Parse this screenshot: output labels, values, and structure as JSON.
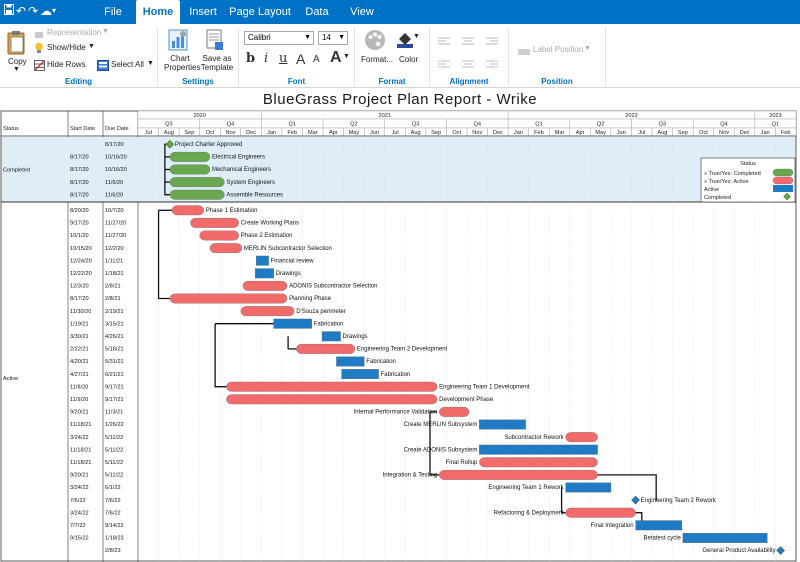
{
  "menu": {
    "tabs": [
      {
        "label": "File"
      },
      {
        "label": "Home"
      },
      {
        "label": "Insert"
      },
      {
        "label": "Page Layout"
      },
      {
        "label": "Data"
      },
      {
        "label": "View"
      }
    ],
    "active_tab": "Home"
  },
  "ribbon": {
    "editing": {
      "group_label": "Editing",
      "copy": "Copy",
      "representation": "Representation",
      "show_hide": "Show/Hide",
      "hide_rows": "Hide Rows",
      "select_all": "Select All"
    },
    "settings": {
      "group_label": "Settings",
      "chart_properties": "Chart Properties",
      "save_template": "Save as Template"
    },
    "font": {
      "group_label": "Font",
      "family": "Calibri",
      "size": "14"
    },
    "format": {
      "group_label": "Format",
      "format_btn": "Format...",
      "color_btn": "Color"
    },
    "alignment": {
      "group_label": "Alignment"
    },
    "position": {
      "group_label": "Position",
      "label_position": "Label Position"
    }
  },
  "report": {
    "title": "BlueGrass Project Plan Report - Wrike",
    "headers": {
      "status": "Status",
      "start": "Start Date",
      "due": "Due Date"
    },
    "years": [
      "2020",
      "2021",
      "2022",
      "2023"
    ],
    "quarters": [
      "Q3",
      "Q4",
      "Q1",
      "Q2",
      "Q3",
      "Q4",
      "Q1",
      "Q2",
      "Q3",
      "Q4",
      "Q1"
    ],
    "months": [
      "Jul",
      "Aug",
      "Sep",
      "Oct",
      "Nov",
      "Dec",
      "Jan",
      "Feb",
      "Mar",
      "Apr",
      "May",
      "Jun",
      "Jul",
      "Aug",
      "Sep",
      "Oct",
      "Nov",
      "Dec",
      "Jan",
      "Feb",
      "Mar",
      "Apr",
      "May",
      "Jun",
      "Jul",
      "Aug",
      "Sep",
      "Oct",
      "Nov",
      "Dec",
      "Jan",
      "Feb"
    ],
    "groups": [
      {
        "label": "Completed"
      },
      {
        "label": "Active"
      }
    ],
    "legend": {
      "title": "Status",
      "items": [
        {
          "label": "» True/Yes: Completed",
          "color": "#6aa84f"
        },
        {
          "label": "» True/Yes: Active",
          "color": "#f26b6b"
        },
        {
          "label": "Active",
          "color": "#1e7bc4"
        },
        {
          "label": "Completed",
          "color": "#5aa83a"
        }
      ]
    },
    "colors": {
      "completed": "#6aa84f",
      "red": "#f26b6b",
      "blue": "#1e7bc4",
      "milestone_green": "#5aa83a",
      "milestone_blue": "#1e7bc4",
      "completed_band": "#dfeef6"
    },
    "tasks": [
      {
        "start": "",
        "due": "8/17/20",
        "name": "Project Charter Approved",
        "type": "milestone_green",
        "s": 1.55,
        "e": 1.55,
        "group": 0
      },
      {
        "start": "8/17/20",
        "due": "10/16/20",
        "name": "Electrical Engineers",
        "type": "completed",
        "s": 1.55,
        "e": 3.5,
        "group": 0
      },
      {
        "start": "8/17/20",
        "due": "10/16/20",
        "name": "Mechanical Engineers",
        "type": "completed",
        "s": 1.55,
        "e": 3.5,
        "group": 0
      },
      {
        "start": "8/17/20",
        "due": "11/6/20",
        "name": "System Engineers",
        "type": "completed",
        "s": 1.55,
        "e": 4.2,
        "group": 0
      },
      {
        "start": "8/17/20",
        "due": "11/6/20",
        "name": "Assemble Resources",
        "type": "completed",
        "s": 1.55,
        "e": 4.2,
        "group": 0
      },
      {
        "start": "8/20/20",
        "due": "10/7/20",
        "name": "Phase 1 Estimation",
        "type": "red",
        "s": 1.65,
        "e": 3.2,
        "group": 1
      },
      {
        "start": "9/17/20",
        "due": "11/27/20",
        "name": "Create Working Plans",
        "type": "red",
        "s": 2.55,
        "e": 4.9,
        "group": 1
      },
      {
        "start": "10/1/20",
        "due": "11/27/20",
        "name": "Phase 2 Estimation",
        "type": "red",
        "s": 3.0,
        "e": 4.9,
        "group": 1
      },
      {
        "start": "10/15/20",
        "due": "12/2/20",
        "name": "MERLIN Subcontractor Selection",
        "type": "red",
        "s": 3.5,
        "e": 5.05,
        "group": 1
      },
      {
        "start": "12/24/20",
        "due": "1/11/21",
        "name": "Financial review",
        "type": "blue",
        "s": 5.75,
        "e": 6.35,
        "group": 1
      },
      {
        "start": "12/22/20",
        "due": "1/18/21",
        "name": "Drawings",
        "type": "blue",
        "s": 5.7,
        "e": 6.6,
        "group": 1
      },
      {
        "start": "12/3/20",
        "due": "2/8/21",
        "name": "ADONIS Subcontractor Selection",
        "type": "red",
        "s": 5.1,
        "e": 7.25,
        "group": 1
      },
      {
        "start": "8/17/20",
        "due": "2/8/21",
        "name": "Planning Phase",
        "type": "red",
        "s": 1.55,
        "e": 7.25,
        "group": 1
      },
      {
        "start": "11/30/20",
        "due": "2/19/21",
        "name": "D'Souza perimeter",
        "type": "red",
        "s": 5.0,
        "e": 7.6,
        "group": 1
      },
      {
        "start": "1/19/21",
        "due": "3/15/21",
        "name": "Fabrication",
        "type": "blue",
        "s": 6.6,
        "e": 8.45,
        "group": 1
      },
      {
        "start": "3/30/21",
        "due": "4/26/21",
        "name": "Drawings",
        "type": "blue",
        "s": 8.95,
        "e": 9.85,
        "group": 1
      },
      {
        "start": "2/22/21",
        "due": "5/18/21",
        "name": "Engineering Team 2 Development",
        "type": "red",
        "s": 7.7,
        "e": 10.55,
        "group": 1
      },
      {
        "start": "4/20/21",
        "due": "5/31/21",
        "name": "Fabrication",
        "type": "blue",
        "s": 9.65,
        "e": 11.0,
        "group": 1
      },
      {
        "start": "4/27/21",
        "due": "6/21/21",
        "name": "Fabrication",
        "type": "blue",
        "s": 9.9,
        "e": 11.7,
        "group": 1
      },
      {
        "start": "11/9/20",
        "due": "9/17/21",
        "name": "Engineering Team 1 Development",
        "type": "red",
        "s": 4.3,
        "e": 14.55,
        "group": 1
      },
      {
        "start": "11/9/20",
        "due": "9/17/21",
        "name": "Development Phase",
        "type": "red",
        "s": 4.3,
        "e": 14.55,
        "group": 1
      },
      {
        "start": "9/20/21",
        "due": "11/3/21",
        "name": "Internal Performance Validation",
        "type": "red",
        "s": 14.65,
        "e": 16.1,
        "group": 1
      },
      {
        "start": "11/18/21",
        "due": "1/26/22",
        "name": "Create MERLIN Subsystem",
        "type": "blue",
        "s": 16.6,
        "e": 18.85,
        "group": 1
      },
      {
        "start": "3/24/22",
        "due": "5/11/22",
        "name": "Subcontractor Rework",
        "type": "red",
        "s": 20.8,
        "e": 22.35,
        "group": 1
      },
      {
        "start": "11/18/21",
        "due": "5/11/22",
        "name": "Create ADONIS Subsystem",
        "type": "blue",
        "s": 16.6,
        "e": 22.35,
        "group": 1
      },
      {
        "start": "11/18/21",
        "due": "5/11/22",
        "name": "Final Rollup",
        "type": "red",
        "s": 16.6,
        "e": 22.35,
        "group": 1
      },
      {
        "start": "9/20/21",
        "due": "5/11/22",
        "name": "Integration & Testing",
        "type": "red",
        "s": 14.65,
        "e": 22.35,
        "group": 1
      },
      {
        "start": "3/24/22",
        "due": "6/1/22",
        "name": "Engineering Team 1 Rework",
        "type": "blue",
        "s": 20.8,
        "e": 23.0,
        "group": 1
      },
      {
        "start": "7/6/22",
        "due": "7/6/22",
        "name": "Engineering Team 2 Rework",
        "type": "milestone_blue",
        "s": 24.2,
        "e": 24.2,
        "group": 1
      },
      {
        "start": "3/24/22",
        "due": "7/6/22",
        "name": "Refactoring & Deployment",
        "type": "red",
        "s": 20.8,
        "e": 24.2,
        "group": 1
      },
      {
        "start": "7/7/22",
        "due": "9/14/22",
        "name": "Final Integration",
        "type": "blue",
        "s": 24.2,
        "e": 26.45,
        "group": 1
      },
      {
        "start": "9/15/22",
        "due": "1/18/23",
        "name": "Betatest cycle",
        "type": "blue",
        "s": 26.5,
        "e": 30.6,
        "group": 1
      },
      {
        "start": "",
        "due": "2/8/23",
        "name": "General Product Availability",
        "type": "milestone_blue",
        "s": 31.25,
        "e": 31.25,
        "group": 1
      }
    ]
  }
}
